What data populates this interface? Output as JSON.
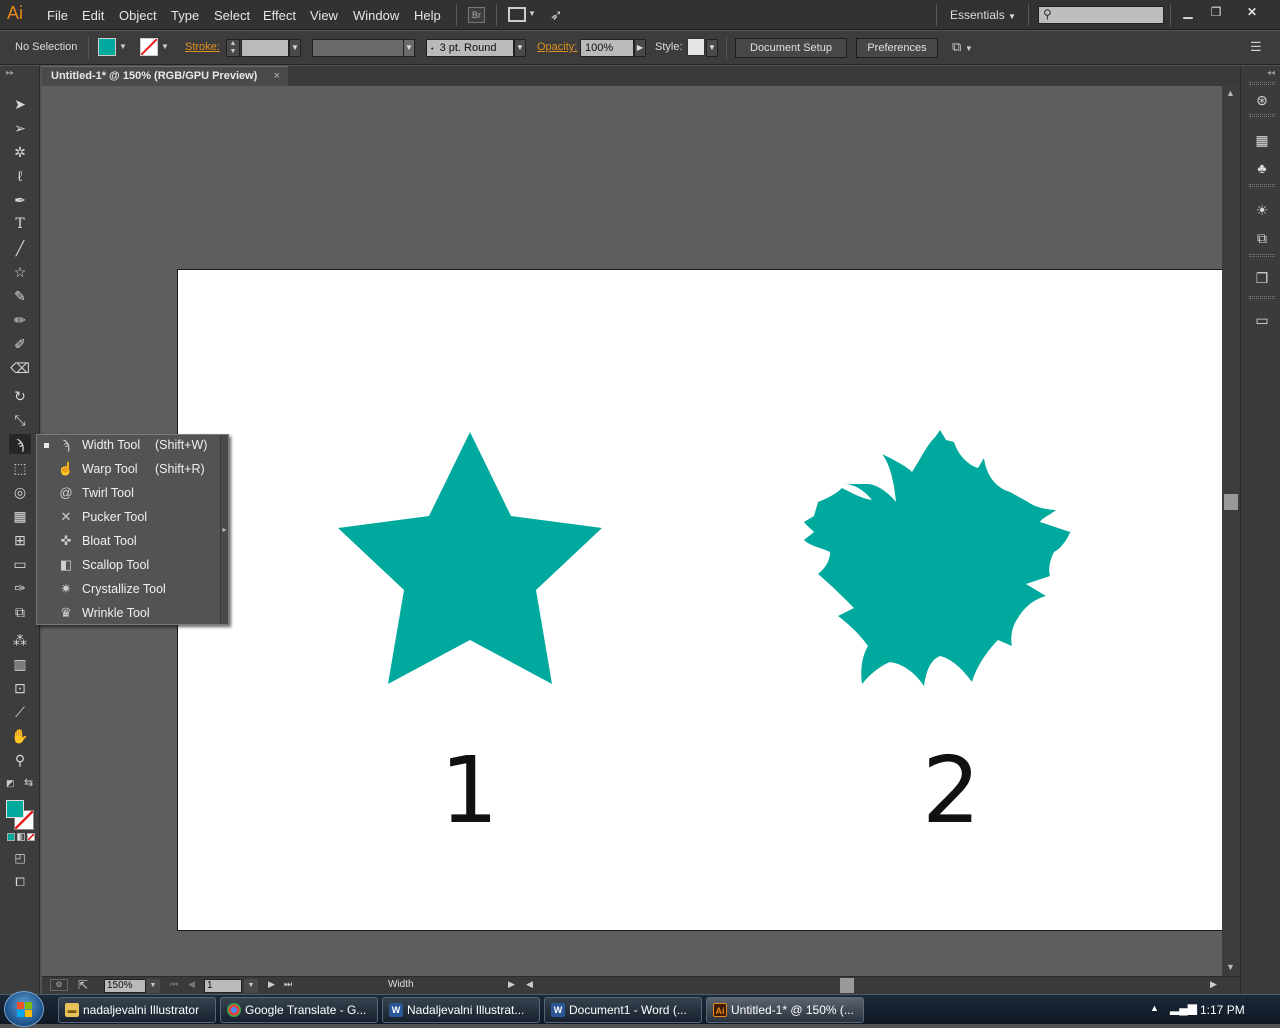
{
  "app": {
    "logo": "Ai",
    "menus": [
      "File",
      "Edit",
      "Object",
      "Type",
      "Select",
      "Effect",
      "View",
      "Window",
      "Help"
    ],
    "bridge_label": "Br",
    "workspace": "Essentials",
    "search_placeholder": ""
  },
  "control_bar": {
    "selection": "No Selection",
    "stroke_label": "Stroke:",
    "brush_value": "3 pt. Round",
    "opacity_label": "Opacity:",
    "opacity_value": "100%",
    "style_label": "Style:",
    "document_setup": "Document Setup",
    "preferences": "Preferences",
    "fill_color": "#00a99d"
  },
  "document": {
    "tab_title": "Untitled-1* @ 150% (RGB/GPU Preview)",
    "tab_close": "×"
  },
  "artwork": {
    "shape_color": "#00a99d",
    "label_1": "1",
    "label_2": "2"
  },
  "flyout": {
    "items": [
      {
        "label": "Width Tool",
        "shortcut": "(Shift+W)",
        "icon": "width-tool-icon",
        "selected": true
      },
      {
        "label": "Warp Tool",
        "shortcut": "(Shift+R)",
        "icon": "warp-tool-icon"
      },
      {
        "label": "Twirl Tool",
        "shortcut": "",
        "icon": "twirl-tool-icon"
      },
      {
        "label": "Pucker Tool",
        "shortcut": "",
        "icon": "pucker-tool-icon"
      },
      {
        "label": "Bloat Tool",
        "shortcut": "",
        "icon": "bloat-tool-icon"
      },
      {
        "label": "Scallop Tool",
        "shortcut": "",
        "icon": "scallop-tool-icon"
      },
      {
        "label": "Crystallize Tool",
        "shortcut": "",
        "icon": "crystallize-tool-icon"
      },
      {
        "label": "Wrinkle Tool",
        "shortcut": "",
        "icon": "wrinkle-tool-icon"
      }
    ]
  },
  "status_bar": {
    "zoom": "150%",
    "artboard_number": "1",
    "current_tool": "Width"
  },
  "taskbar": {
    "items": [
      {
        "label": "nadaljevalni Illustrator",
        "icon": "folder-icon"
      },
      {
        "label": "Google Translate - G...",
        "icon": "chrome-icon"
      },
      {
        "label": "Nadaljevalni Illustrat...",
        "icon": "word-icon"
      },
      {
        "label": "Document1 - Word (...",
        "icon": "word-icon"
      },
      {
        "label": "Untitled-1* @ 150% (...",
        "icon": "illustrator-icon"
      }
    ],
    "clock": "1:17 PM"
  }
}
